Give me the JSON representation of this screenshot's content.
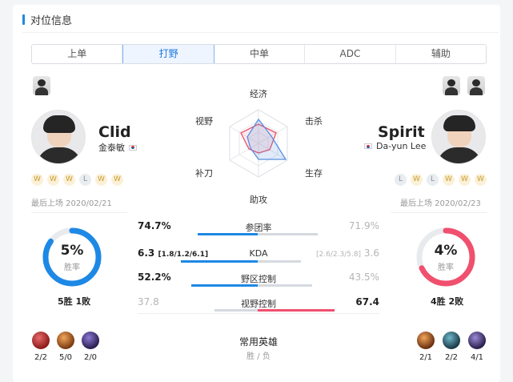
{
  "section_title": "对位信息",
  "tabs": [
    {
      "label": "上单",
      "active": false
    },
    {
      "label": "打野",
      "active": true
    },
    {
      "label": "中单",
      "active": false
    },
    {
      "label": "ADC",
      "active": false
    },
    {
      "label": "辅助",
      "active": false
    }
  ],
  "left_player": {
    "name": "Clid",
    "real_name": "金泰敏",
    "form": [
      "W",
      "W",
      "W",
      "L",
      "W",
      "W"
    ],
    "last_played": "最后上场 2020/02/21",
    "win_rate": 5,
    "win_rate_text": "5%",
    "win_rate_label": "胜率",
    "record": "5胜 1败",
    "ring_color": "#1e88e5",
    "champion_scores": [
      "2/2",
      "5/0",
      "2/0"
    ]
  },
  "right_player": {
    "name": "Spirit",
    "real_name": "Da-yun Lee",
    "form": [
      "L",
      "W",
      "L",
      "W",
      "W",
      "W"
    ],
    "last_played": "最后上场 2020/02/23",
    "win_rate": 4,
    "win_rate_text": "4%",
    "win_rate_label": "胜率",
    "record": "4胜 2败",
    "ring_color": "#f0506e",
    "champion_scores": [
      "2/1",
      "2/2",
      "4/1"
    ]
  },
  "radar": {
    "labels": {
      "top": "经济",
      "top_right": "击杀",
      "bottom_right": "生存",
      "bottom": "助攻",
      "bottom_left": "补刀",
      "top_left": "视野"
    },
    "left_color": "#5a8fe0",
    "right_color": "#e8506a"
  },
  "stats": [
    {
      "label": "参团率",
      "left": "74.7%",
      "left_detail": "",
      "right": "71.9%",
      "right_detail": "",
      "leader": "left",
      "left_share": 0.5,
      "right_share": 0.5
    },
    {
      "label": "KDA",
      "left": "6.3",
      "left_detail": "[1.8/1.2/6.1]",
      "right": "3.6",
      "right_detail": "[2.6/2.3/5.8]",
      "leader": "left",
      "left_share": 0.64,
      "right_share": 0.36
    },
    {
      "label": "野区控制",
      "left": "52.2%",
      "left_detail": "",
      "right": "43.5%",
      "right_detail": "",
      "leader": "left",
      "left_share": 0.55,
      "right_share": 0.45
    },
    {
      "label": "视野控制",
      "left": "37.8",
      "left_detail": "",
      "right": "67.4",
      "right_detail": "",
      "leader": "right",
      "left_share": 0.36,
      "right_share": 0.64
    }
  ],
  "common_heroes": {
    "title": "常用英雄",
    "subtitle": "胜 / 负"
  }
}
